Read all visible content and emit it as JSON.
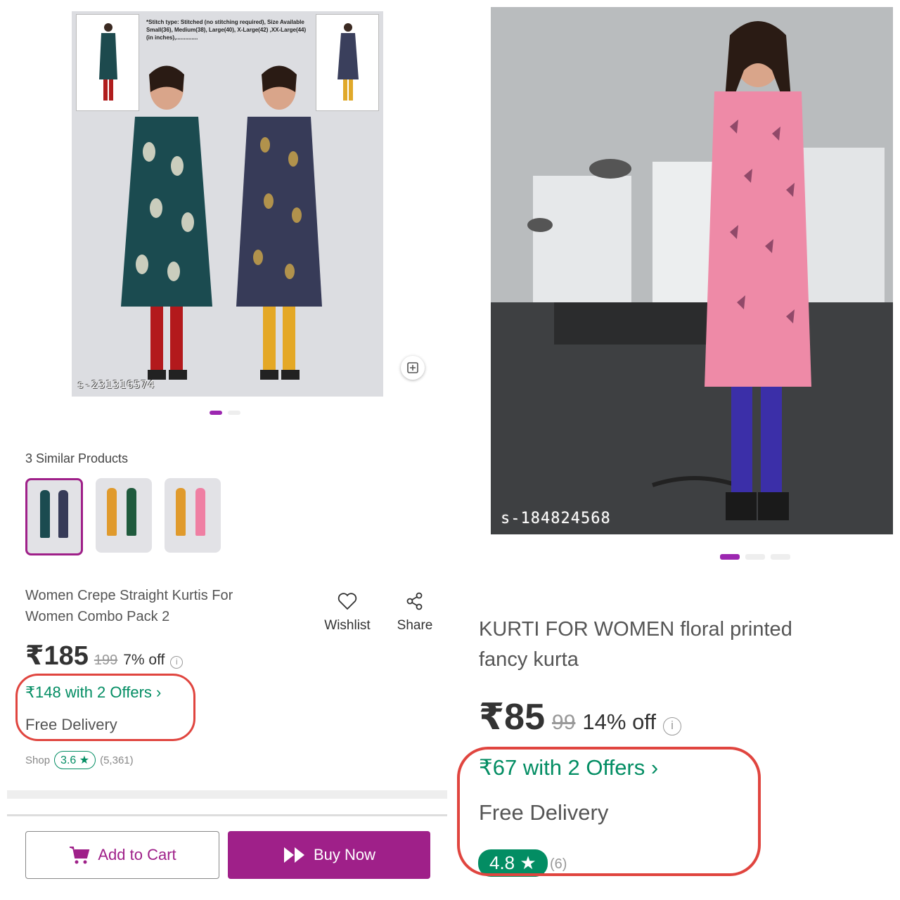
{
  "left": {
    "image": {
      "stitch_note": "*Stitch type: Stitched (no stitching required), Size Available Small(36), Medium(38), Large(40), X-Large(42) ,XX-Large(44)(in inches),..............",
      "code": "s-231316574"
    },
    "similar_title": "3 Similar Products",
    "product_title": "Women Crepe Straight Kurtis For Women Combo Pack 2",
    "actions": {
      "wishlist": "Wishlist",
      "share": "Share"
    },
    "price": "₹185",
    "mrp": "199",
    "discount": "7% off",
    "offer": "₹148 with 2 Offers",
    "delivery": "Free Delivery",
    "shop_label": "Shop",
    "rating": "3.6",
    "rating_count": "(5,361)",
    "add_to_cart": "Add to Cart",
    "buy_now": "Buy Now"
  },
  "right": {
    "image": {
      "code": "s-184824568"
    },
    "product_title": "KURTI FOR WOMEN floral printed fancy kurta",
    "price": "₹85",
    "mrp": "99",
    "discount": "14% off",
    "offer": "₹67 with 2 Offers",
    "delivery": "Free Delivery",
    "rating": "4.8",
    "rating_count": "(6)"
  },
  "colors": {
    "brand": "#9f2089",
    "green": "#038d63",
    "highlight": "#e0453f"
  }
}
